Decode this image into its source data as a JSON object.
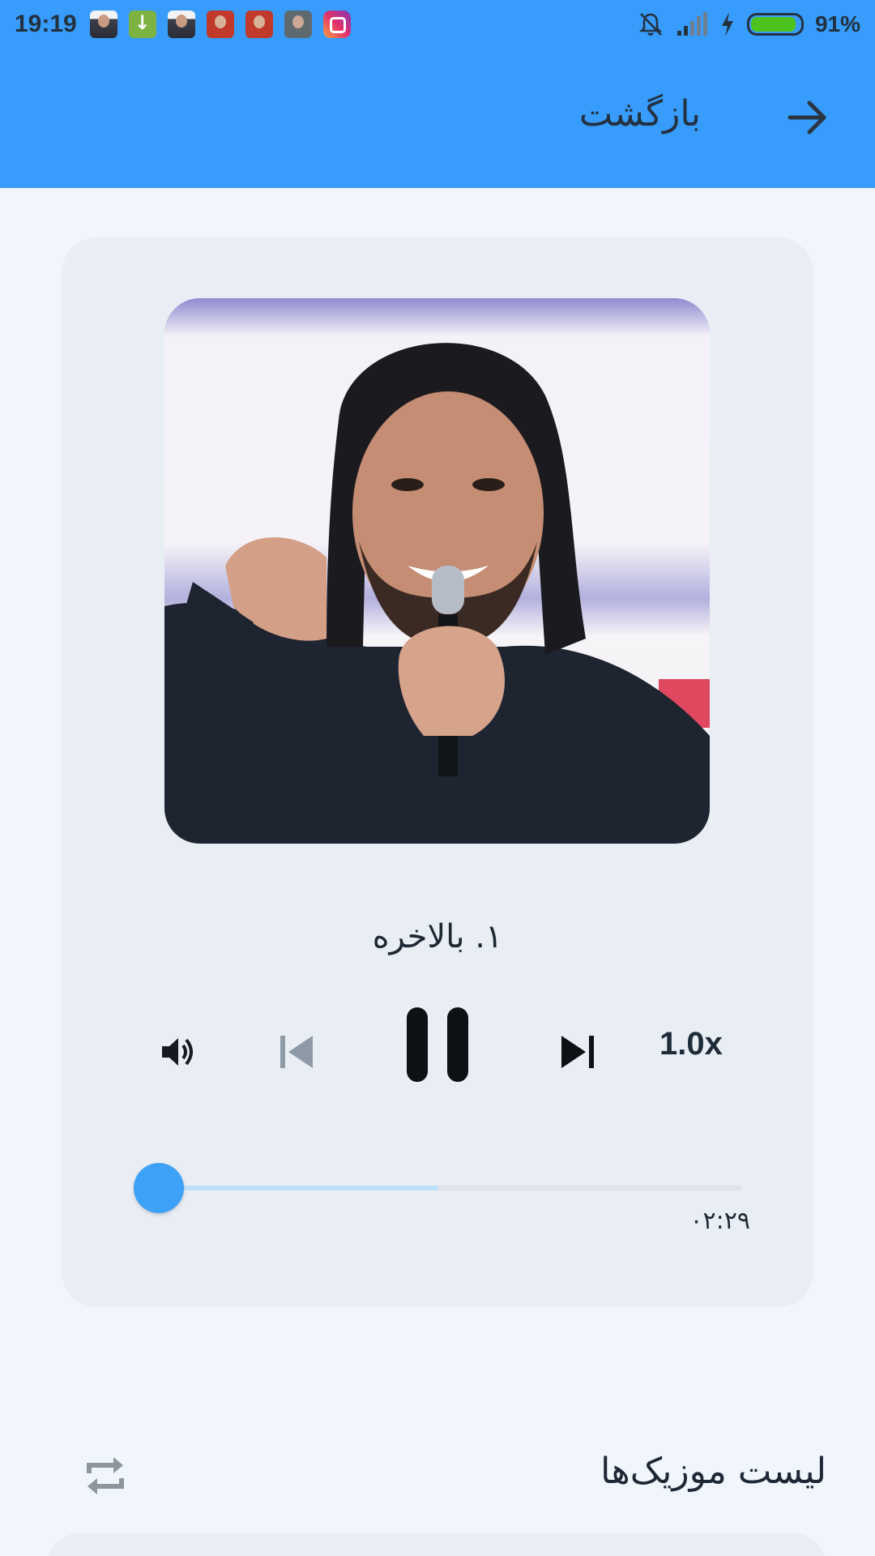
{
  "status_bar": {
    "time": "19:19",
    "battery_percent_label": "91%",
    "battery_level": 0.91,
    "notification_icons": [
      "contact-photo-icon",
      "download-icon",
      "contact-photo-icon",
      "contact-photo-icon",
      "contact-photo-icon",
      "contact-photo-icon",
      "instagram-icon"
    ],
    "system_icons": [
      "bell-muted-icon",
      "signal-icon",
      "charging-icon",
      "battery-icon"
    ]
  },
  "header": {
    "back_label": "بازگشت",
    "back_icon": "arrow-right-icon",
    "background_color": "#379cfb"
  },
  "player": {
    "cover_image": "artist-cover-photo",
    "track_title": "۱. بالاخره",
    "controls": {
      "volume_icon": "volume-icon",
      "previous_icon": "skip-previous-icon",
      "play_state_icon": "pause-icon",
      "next_icon": "skip-next-icon",
      "speed_label": "1.0x"
    },
    "progress": {
      "played_fraction": 0.0,
      "buffered_fraction": 0.5,
      "time_label": "۰۲:۲۹"
    },
    "accent_color": "#3ea1f8"
  },
  "playlist": {
    "title": "لیست موزیک‌ها",
    "repeat_icon": "repeat-icon"
  }
}
